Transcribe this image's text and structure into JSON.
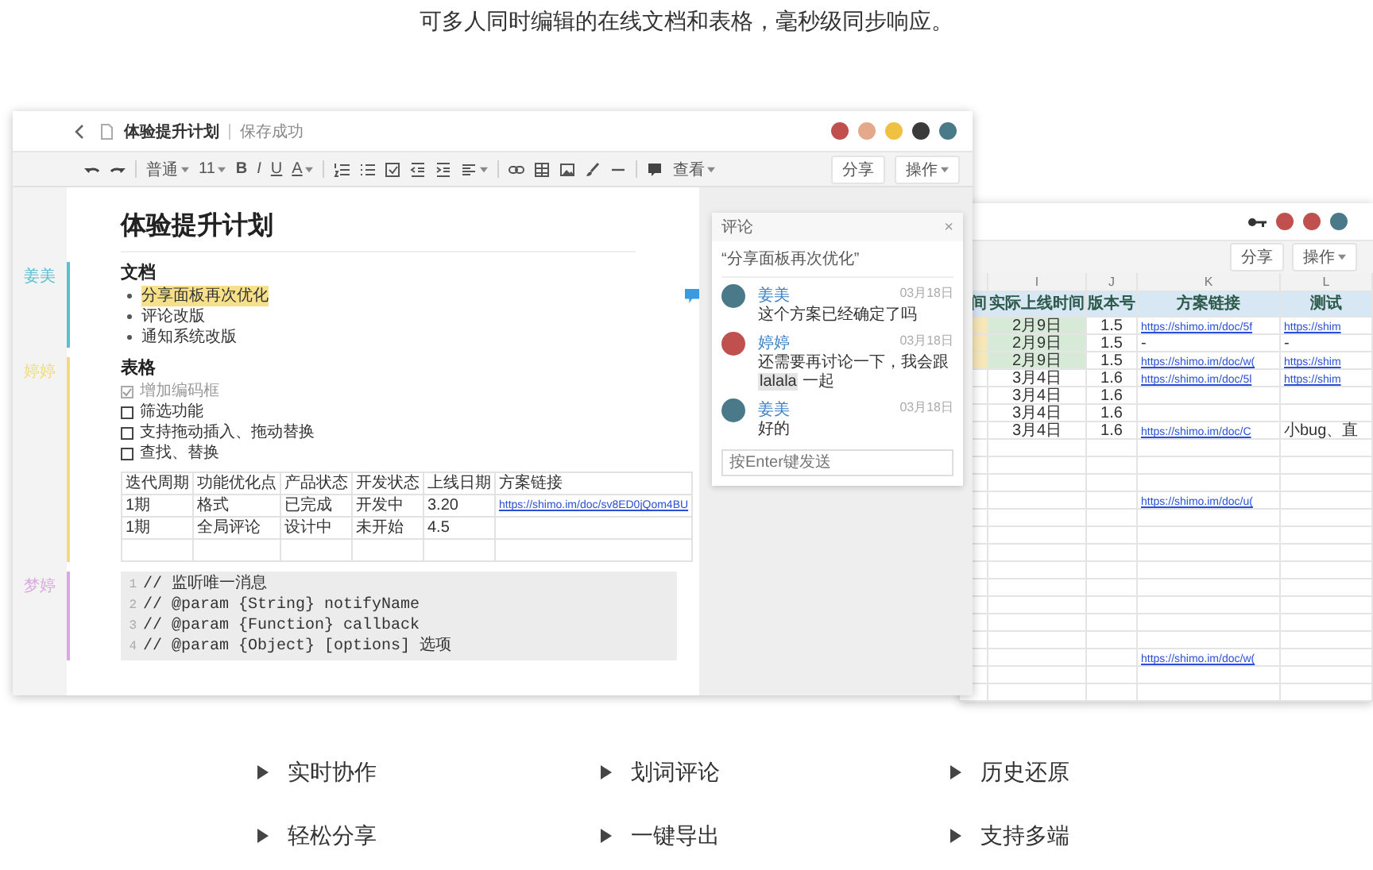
{
  "heading": "可多人同时编辑的在线文档和表格，毫秒级同步响应。",
  "doc_window": {
    "title": "体验提升计划",
    "save_status": "保存成功",
    "toolbar": {
      "paragraph_style": "普通",
      "font_size": "11",
      "bold": "B",
      "italic": "I",
      "underline": "U",
      "text_color": "A",
      "view": "查看"
    },
    "buttons": [
      "分享",
      "操作"
    ],
    "document": {
      "title": "体验提升计划",
      "sections": [
        {
          "kind": "bullets",
          "author": {
            "name": "姜美",
            "color": "#5bbfd0"
          },
          "heading": "文档",
          "items": [
            {
              "text": "分享面板再次优化",
              "highlighted": true
            },
            {
              "text": "评论改版",
              "highlighted": false
            },
            {
              "text": "通知系统改版",
              "highlighted": false
            }
          ]
        },
        {
          "kind": "checklist",
          "author": {
            "name": "婷婷",
            "color": "#f0dc7a"
          },
          "heading": "表格",
          "items": [
            {
              "text": "增加编码框",
              "checked": true
            },
            {
              "text": "筛选功能",
              "checked": false
            },
            {
              "text": "支持拖动插入、拖动替换",
              "checked": false
            },
            {
              "text": "查找、替换",
              "checked": false
            }
          ],
          "table": {
            "columns": [
              "迭代周期",
              "功能优化点",
              "产品状态",
              "开发状态",
              "上线日期",
              "方案链接"
            ],
            "rows": [
              {
                "cells": [
                  "1期",
                  "格式",
                  "已完成",
                  "开发中",
                  "3.20"
                ],
                "link": "https://shimo.im/doc/sv8ED0jQom4BU"
              },
              {
                "cells": [
                  "1期",
                  "全局评论",
                  "设计中",
                  "未开始",
                  "4.5"
                ]
              }
            ]
          }
        },
        {
          "kind": "code",
          "author": {
            "name": "梦婷",
            "color": "#d9a8e0"
          },
          "lines": [
            {
              "number": "1",
              "text": "// 监听唯一消息"
            },
            {
              "number": "2",
              "text": "// @param {String} notifyName"
            },
            {
              "number": "3",
              "text": "// @param {Function} callback"
            },
            {
              "number": "4",
              "text": "// @param {Object} [options] 选项"
            }
          ]
        }
      ]
    },
    "comments": {
      "title": "评论",
      "close": "×",
      "quote": "“分享面板再次优化”",
      "items": [
        {
          "author": "姜美",
          "date": "03月18日",
          "text": "这个方案已经确定了吗"
        },
        {
          "author": "婷婷",
          "date": "03月18日",
          "text": "还需要再讨论一下，我会跟",
          "mention": "lalala",
          "text_after": "一起"
        },
        {
          "author": "姜美",
          "date": "03月18日",
          "text": "好的"
        }
      ],
      "placeholder": "按Enter键发送"
    }
  },
  "sheet_window": {
    "buttons": [
      "分享",
      "操作"
    ],
    "column_letters": [
      "I",
      "J",
      "K",
      "L"
    ],
    "headers": [
      "间",
      "实际上线时间",
      "版本号",
      "方案链接",
      "测试"
    ],
    "rows": [
      {
        "marked": true,
        "launch_date": "2月9日",
        "version": "1.5",
        "plan_link": "https://shimo.im/doc/5f",
        "test_link": "https://shim"
      },
      {
        "marked": true,
        "launch_date": "2月9日",
        "version": "1.5",
        "plan_note": "-",
        "test_note": "-"
      },
      {
        "marked": true,
        "launch_date": "2月9日",
        "version": "1.5",
        "plan_link": "https://shimo.im/doc/w(",
        "test_link": "https://shim"
      },
      {
        "marked": false,
        "launch_date": "3月4日",
        "version": "1.6",
        "plan_link": "https://shimo.im/doc/5l",
        "test_link": "https://shim"
      },
      {
        "marked": false,
        "launch_date": "3月4日",
        "version": "1.6"
      },
      {
        "marked": false,
        "launch_date": "3月4日",
        "version": "1.6"
      },
      {
        "marked": false,
        "launch_date": "3月4日",
        "version": "1.6",
        "plan_link": "https://shimo.im/doc/C",
        "test_note": "小bug、直"
      },
      {
        "marked": false
      },
      {
        "marked": false
      },
      {
        "marked": false
      },
      {
        "marked": false,
        "plan_link": "https://shimo.im/doc/u("
      },
      {
        "marked": false
      },
      {
        "marked": false
      },
      {
        "marked": false
      },
      {
        "marked": false
      },
      {
        "marked": false
      },
      {
        "marked": false
      },
      {
        "marked": false
      },
      {
        "marked": false
      },
      {
        "marked": false,
        "plan_link": "https://shimo.im/doc/w("
      },
      {
        "marked": false
      },
      {
        "marked": false
      }
    ]
  },
  "features": [
    "实时协作",
    "划词评论",
    "历史还原",
    "轻松分享",
    "一键导出",
    "支持多端"
  ]
}
